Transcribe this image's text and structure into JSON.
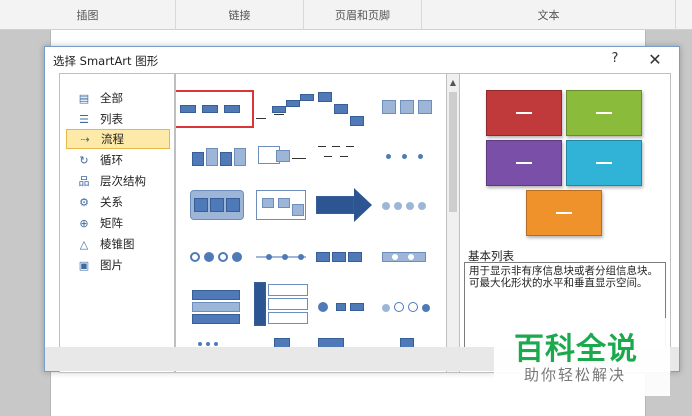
{
  "ribbon": {
    "groups": [
      "插图",
      "链接",
      "页眉和页脚",
      "文本"
    ]
  },
  "dialog": {
    "title": "选择 SmartArt 图形",
    "help_label": "?",
    "close_label": "✕"
  },
  "categories": [
    {
      "label": "全部",
      "icon": "all-icon",
      "glyph": "▤"
    },
    {
      "label": "列表",
      "icon": "list-icon",
      "glyph": "☰"
    },
    {
      "label": "流程",
      "icon": "process-icon",
      "glyph": "⇢",
      "selected": true
    },
    {
      "label": "循环",
      "icon": "cycle-icon",
      "glyph": "↻"
    },
    {
      "label": "层次结构",
      "icon": "hierarchy-icon",
      "glyph": "品"
    },
    {
      "label": "关系",
      "icon": "relationship-icon",
      "glyph": "⚙"
    },
    {
      "label": "矩阵",
      "icon": "matrix-icon",
      "glyph": "⊕"
    },
    {
      "label": "棱锥图",
      "icon": "pyramid-icon",
      "glyph": "△"
    },
    {
      "label": "图片",
      "icon": "picture-icon",
      "glyph": "▣"
    }
  ],
  "preview": {
    "name": "基本列表",
    "description": "用于显示非有序信息块或者分组信息块。可最大化形状的水平和垂直显示空间。",
    "colors": {
      "red": "#c0393b",
      "green": "#8bbb3b",
      "purple": "#7a4fa8",
      "cyan": "#31b3d8",
      "orange": "#f0922c"
    }
  },
  "accent": {
    "selection_border": "#d9363a",
    "selected_category_bg": "#fde9a8"
  },
  "watermark": {
    "line1": "百科全说",
    "line2": "助你轻松解决"
  }
}
